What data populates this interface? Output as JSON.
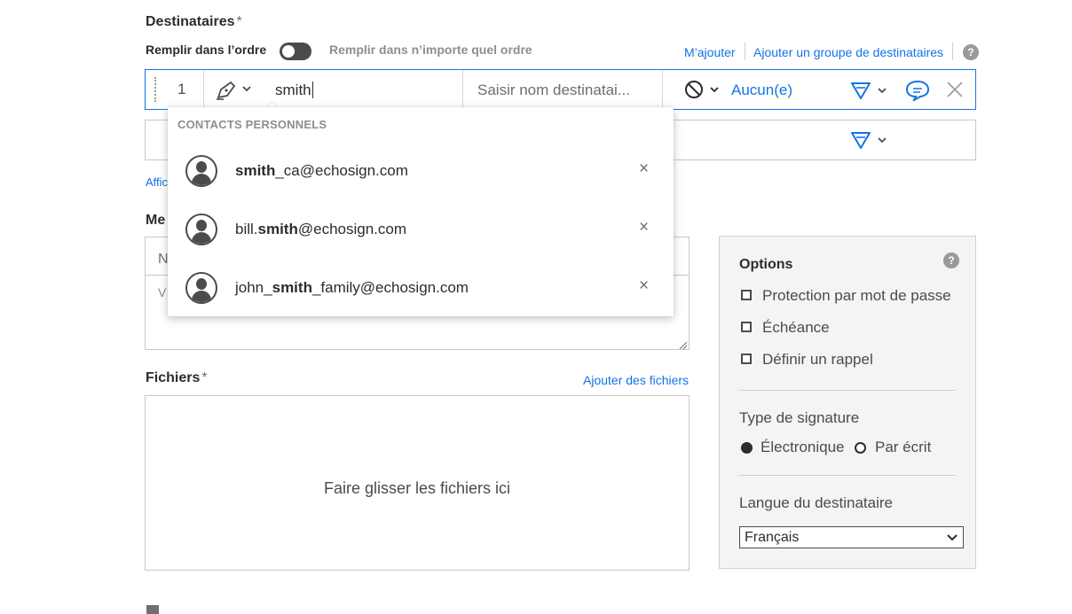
{
  "recipients": {
    "title": "Destinataires",
    "required_mark": "*",
    "fill_in_order": "Remplir dans l’ordre",
    "fill_any_order": "Remplir dans n’importe quel ordre",
    "add_me": "M’ajouter",
    "add_group": "Ajouter un groupe de destinataires",
    "help": "?",
    "row1": {
      "number": "1",
      "email_value": "smith",
      "name_placeholder": "Saisir nom destinatai...",
      "auth_value": "Aucun(e)"
    },
    "show_link_partial": "Affic"
  },
  "autocomplete": {
    "header": "CONTACTS PERSONNELS",
    "items": [
      {
        "prefix": "",
        "match": "smith",
        "suffix": "_ca@echosign.com"
      },
      {
        "prefix": "bill.",
        "match": "smith",
        "suffix": "@echosign.com"
      },
      {
        "prefix": "john_",
        "match": "smith",
        "suffix": "_family@echosign.com"
      }
    ],
    "remove_glyph": "×"
  },
  "message": {
    "label_partial": "Me",
    "name_partial": "N",
    "body_partial": "V"
  },
  "files": {
    "title": "Fichiers",
    "required_mark": "*",
    "add_files": "Ajouter des fichiers",
    "drop_text": "Faire glisser les fichiers ici"
  },
  "options": {
    "title": "Options",
    "help": "?",
    "checks": [
      "Protection par mot de passe",
      "Échéance",
      "Définir un rappel"
    ],
    "signature_type_label": "Type de signature",
    "signature_electronic": "Électronique",
    "signature_written": "Par écrit",
    "language_label": "Langue du destinataire",
    "language_value": "Français"
  },
  "colors": {
    "link": "#1473e6",
    "active_border": "#1473e6"
  }
}
